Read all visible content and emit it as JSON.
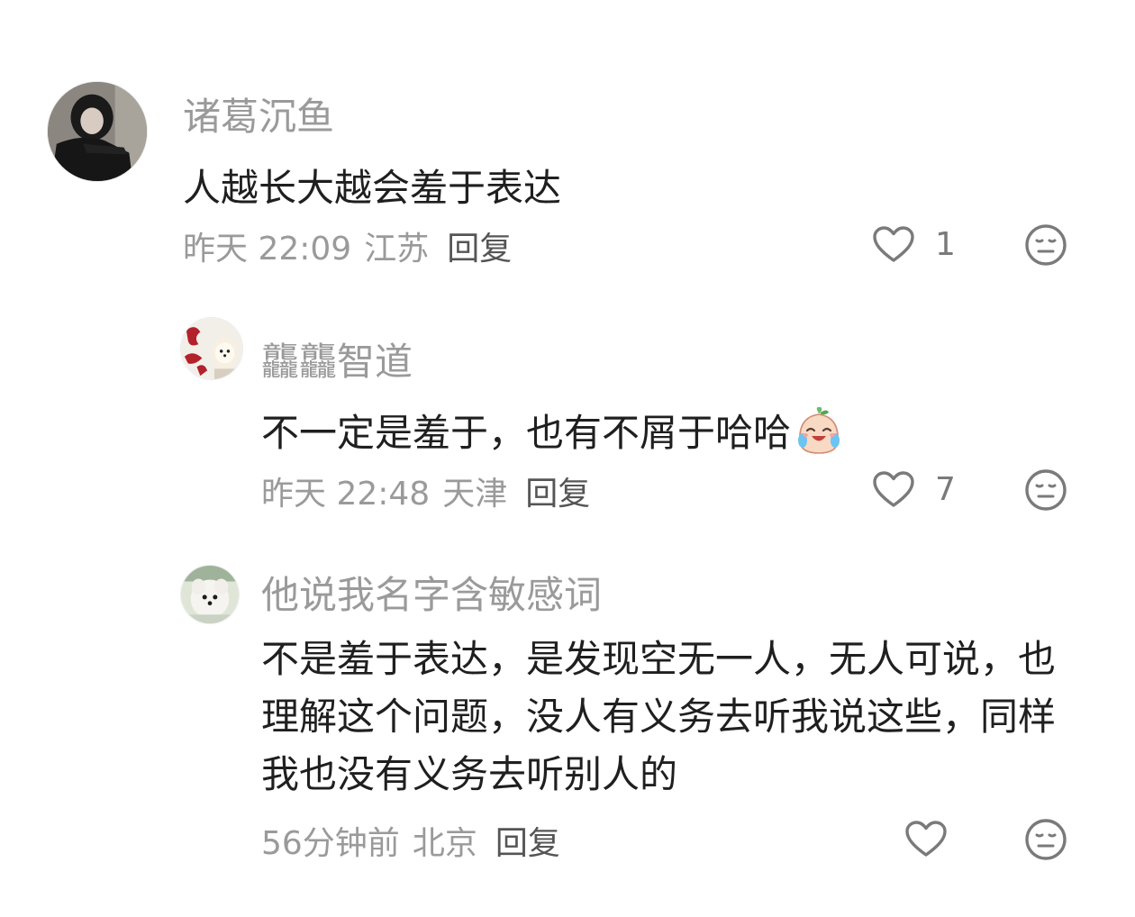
{
  "comments": [
    {
      "username": "诸葛沉鱼",
      "text": "人越长大越会羞于表达",
      "time": "昨天 22:09",
      "location": "江苏",
      "reply_label": "回复",
      "likes": "1"
    },
    {
      "username": "龘龘智道",
      "text": "不一定是羞于，也有不屑于哈哈",
      "emoji": "crying-laughing-sticker-icon",
      "time": "昨天 22:48",
      "location": "天津",
      "reply_label": "回复",
      "likes": "7"
    },
    {
      "username": "他说我名字含敏感词",
      "text": "不是羞于表达，是发现空无一人，无人可说，也理解这个问题，没人有义务去听我说这些，同样我也没有义务去听别人的",
      "time": "56分钟前",
      "location": "北京",
      "reply_label": "回复",
      "likes": ""
    }
  ],
  "colors": {
    "secondary_text": "#9a9a9a",
    "primary_text": "#1f1f1f",
    "icon": "#7a7a7a"
  }
}
